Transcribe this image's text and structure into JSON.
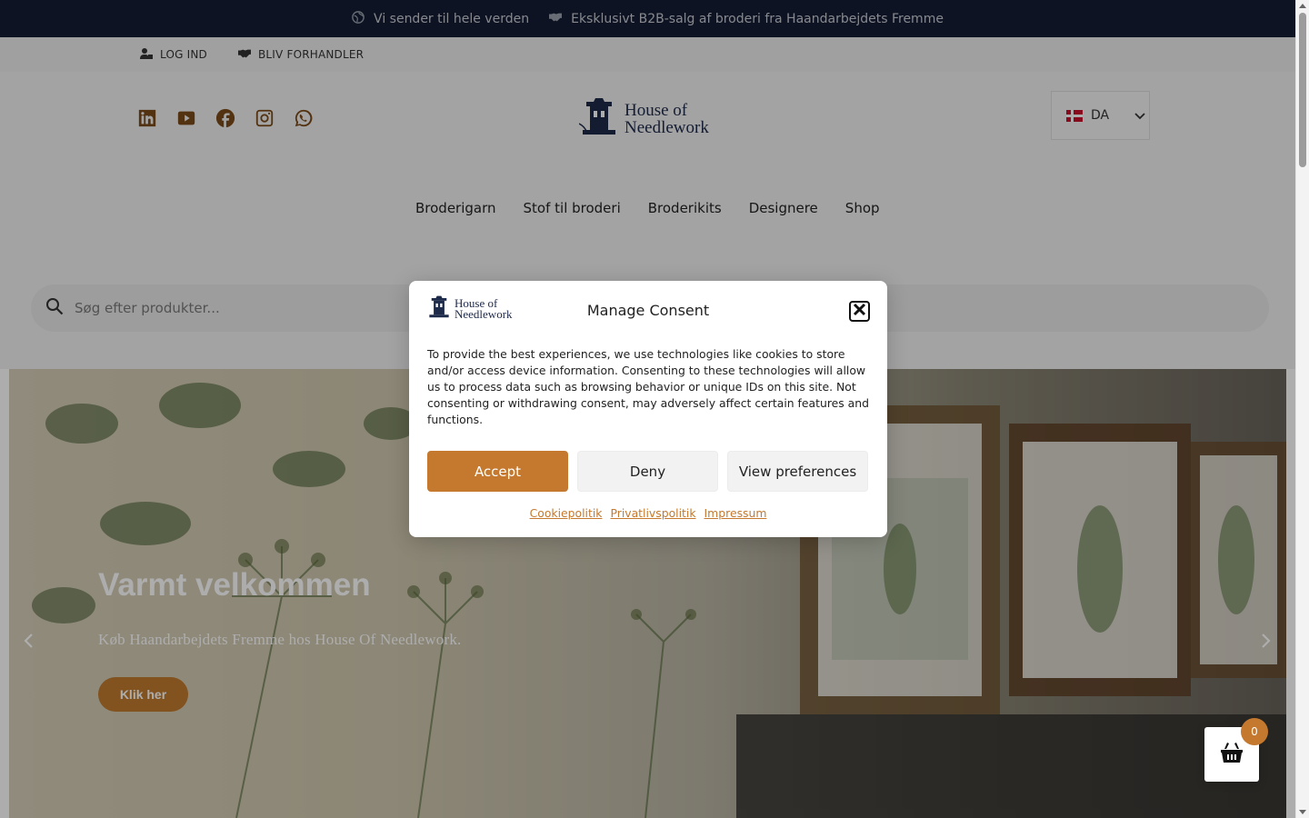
{
  "announcement": {
    "shipping_text": "Vi sender til hele verden",
    "b2b_text": "Eksklusivt B2B-salg af broderi fra Haandarbejdets Fremme"
  },
  "account_bar": {
    "login_label": "LOG IND",
    "dealer_label": "BLIV FORHANDLER"
  },
  "header": {
    "logo_line1": "House of",
    "logo_line2": "Needlework",
    "socials": [
      "linkedin-icon",
      "youtube-icon",
      "facebook-icon",
      "instagram-icon",
      "whatsapp-icon"
    ],
    "language": "DA"
  },
  "nav": {
    "items": [
      "Broderigarn",
      "Stof til broderi",
      "Broderikits",
      "Designere",
      "Shop"
    ]
  },
  "search": {
    "placeholder": "Søg efter produkter..."
  },
  "hero": {
    "title": "Varmt velkommen",
    "subtitle": "Køb Haandarbejdets Fremme hos House Of Needlework.",
    "button_label": "Klik her"
  },
  "consent": {
    "logo_line1": "House of",
    "logo_line2": "Needlework",
    "title": "Manage Consent",
    "body": "To provide the best experiences, we use technologies like cookies to store and/or access device information. Consenting to these technologies will allow us to process data such as browsing behavior or unique IDs on this site. Not consenting or withdrawing consent, may adversely affect certain features and functions.",
    "accept_label": "Accept",
    "deny_label": "Deny",
    "preferences_label": "View preferences",
    "links": [
      "Cookiepolitik",
      "Privatlivspolitik",
      "Impressum"
    ]
  },
  "cart": {
    "count": "0"
  },
  "colors": {
    "topbar_bg": "#141d33",
    "accent": "#c4792e",
    "brand_navy": "#1e2a4a"
  }
}
